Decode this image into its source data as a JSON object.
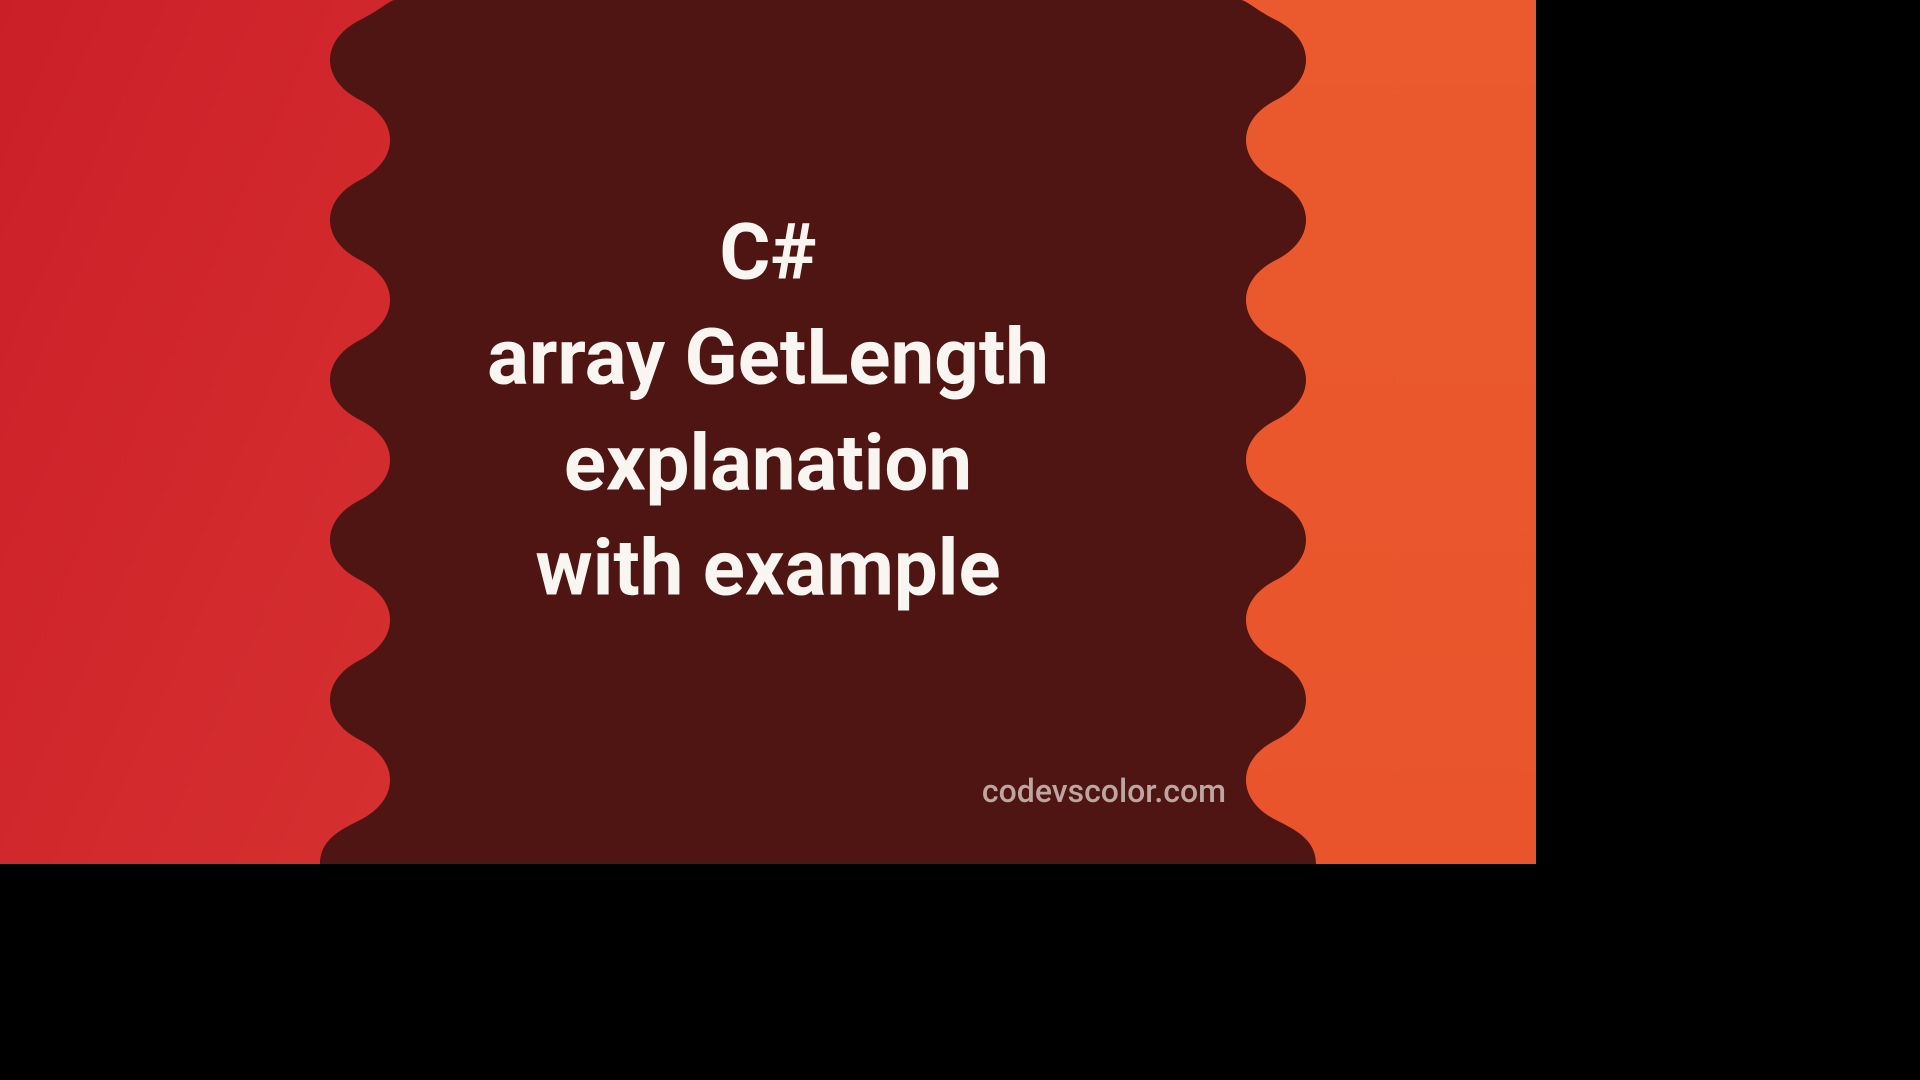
{
  "title_lines": [
    "C#",
    "array GetLength",
    "explanation",
    "with example"
  ],
  "watermark": "codevscolor.com",
  "colors": {
    "bg_dark": "#4f1513",
    "red_left_1": "#cb1f28",
    "red_left_2": "#d63030",
    "orange_right_1": "#e9542c",
    "orange_right_2": "#ea5a2e",
    "text": "#f9f6f2",
    "watermark": "#bda6a2"
  }
}
